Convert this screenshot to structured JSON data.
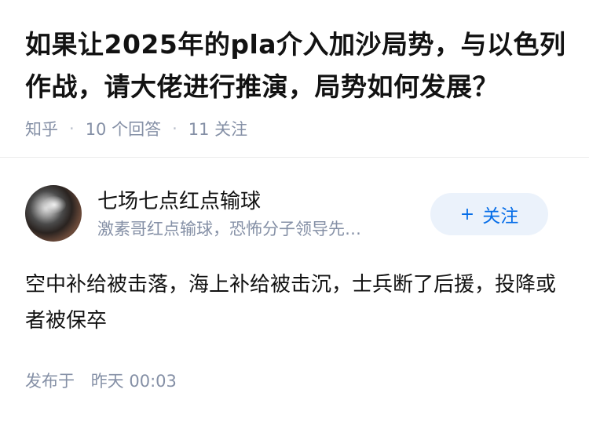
{
  "question": {
    "title": "如果让2025年的pla介入加沙局势，与以色列作战，请大佬进行推演，局势如何发展？",
    "source": "知乎",
    "answer_count": "10 个回答",
    "follow_count": "11 关注"
  },
  "author": {
    "name": "七场七点红点输球",
    "bio": "激素哥红点输球，恐怖分子领导先…",
    "follow_label": "关注",
    "follow_plus": "+"
  },
  "answer": {
    "content": "空中补给被击落，海上补给被击沉，士兵断了后援，投降或者被保卒",
    "published_label": "发布于",
    "published_time": "昨天 00:03"
  },
  "colors": {
    "meta_gray": "#8590a6",
    "accent_blue": "#056de8",
    "button_bg": "#ebf2fb"
  }
}
